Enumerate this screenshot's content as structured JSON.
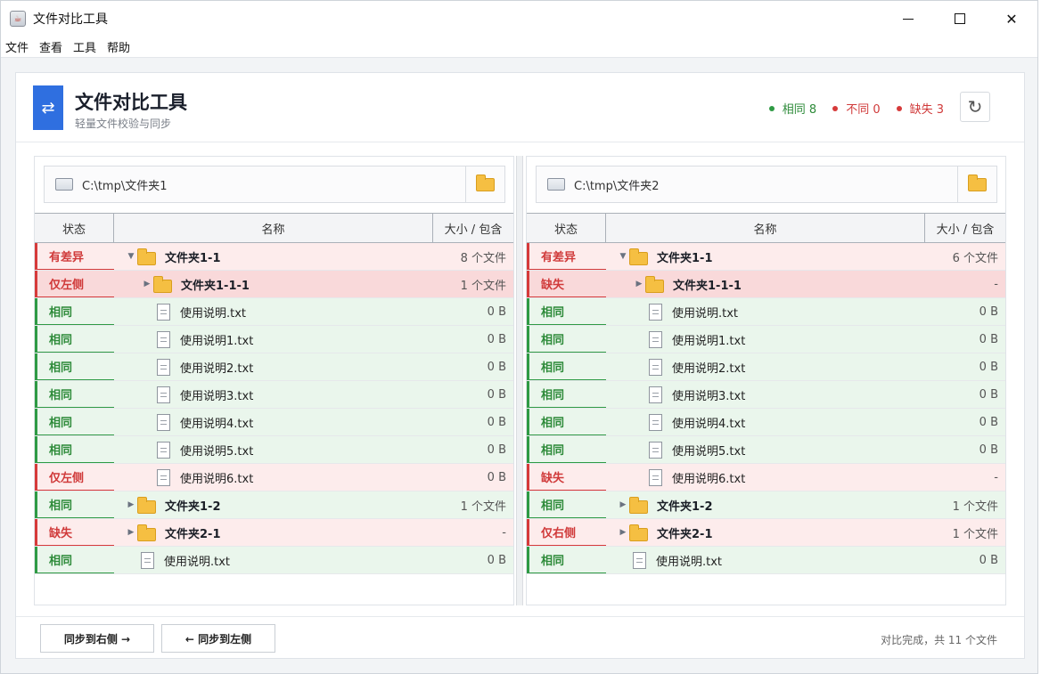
{
  "window": {
    "title": "文件对比工具"
  },
  "menu": [
    "文件",
    "查看",
    "工具",
    "帮助"
  ],
  "header": {
    "title": "文件对比工具",
    "subtitle": "轻量文件校验与同步",
    "stats": [
      {
        "label": "相同 8",
        "color": "#2e8b3a"
      },
      {
        "label": "不同 0",
        "color": "#d03a3a"
      },
      {
        "label": "缺失 3",
        "color": "#d03a3a"
      }
    ]
  },
  "columns": {
    "status": "状态",
    "name": "名称",
    "size": "大小 / 包含"
  },
  "left": {
    "path": "C:\\tmp\\文件夹1",
    "rows": [
      {
        "status": "有差异",
        "kind": "diff",
        "type": "folder",
        "depth": 0,
        "expanded": true,
        "name": "文件夹1-1",
        "size": "8 个文件"
      },
      {
        "status": "仅左侧",
        "kind": "only",
        "type": "folder",
        "depth": 1,
        "expanded": false,
        "name": "文件夹1-1-1",
        "size": "1 个文件"
      },
      {
        "status": "相同",
        "kind": "same",
        "type": "file",
        "depth": 1,
        "name": "使用说明.txt",
        "size": "0 B"
      },
      {
        "status": "相同",
        "kind": "same",
        "type": "file",
        "depth": 1,
        "name": "使用说明1.txt",
        "size": "0 B"
      },
      {
        "status": "相同",
        "kind": "same",
        "type": "file",
        "depth": 1,
        "name": "使用说明2.txt",
        "size": "0 B"
      },
      {
        "status": "相同",
        "kind": "same",
        "type": "file",
        "depth": 1,
        "name": "使用说明3.txt",
        "size": "0 B"
      },
      {
        "status": "相同",
        "kind": "same",
        "type": "file",
        "depth": 1,
        "name": "使用说明4.txt",
        "size": "0 B"
      },
      {
        "status": "相同",
        "kind": "same",
        "type": "file",
        "depth": 1,
        "name": "使用说明5.txt",
        "size": "0 B"
      },
      {
        "status": "仅左侧",
        "kind": "missing",
        "type": "file",
        "depth": 1,
        "name": "使用说明6.txt",
        "size": "0 B"
      },
      {
        "status": "相同",
        "kind": "same",
        "type": "folder",
        "depth": 0,
        "expanded": false,
        "name": "文件夹1-2",
        "size": "1 个文件"
      },
      {
        "status": "缺失",
        "kind": "missing",
        "type": "folder",
        "depth": 0,
        "expanded": false,
        "name": "文件夹2-1",
        "size": "-"
      },
      {
        "status": "相同",
        "kind": "same",
        "type": "file",
        "depth": 0,
        "name": "使用说明.txt",
        "size": "0 B"
      }
    ]
  },
  "right": {
    "path": "C:\\tmp\\文件夹2",
    "rows": [
      {
        "status": "有差异",
        "kind": "diff",
        "type": "folder",
        "depth": 0,
        "expanded": true,
        "name": "文件夹1-1",
        "size": "6 个文件"
      },
      {
        "status": "缺失",
        "kind": "only",
        "type": "folder",
        "depth": 1,
        "expanded": false,
        "name": "文件夹1-1-1",
        "size": "-"
      },
      {
        "status": "相同",
        "kind": "same",
        "type": "file",
        "depth": 1,
        "name": "使用说明.txt",
        "size": "0 B"
      },
      {
        "status": "相同",
        "kind": "same",
        "type": "file",
        "depth": 1,
        "name": "使用说明1.txt",
        "size": "0 B"
      },
      {
        "status": "相同",
        "kind": "same",
        "type": "file",
        "depth": 1,
        "name": "使用说明2.txt",
        "size": "0 B"
      },
      {
        "status": "相同",
        "kind": "same",
        "type": "file",
        "depth": 1,
        "name": "使用说明3.txt",
        "size": "0 B"
      },
      {
        "status": "相同",
        "kind": "same",
        "type": "file",
        "depth": 1,
        "name": "使用说明4.txt",
        "size": "0 B"
      },
      {
        "status": "相同",
        "kind": "same",
        "type": "file",
        "depth": 1,
        "name": "使用说明5.txt",
        "size": "0 B"
      },
      {
        "status": "缺失",
        "kind": "missing",
        "type": "file",
        "depth": 1,
        "name": "使用说明6.txt",
        "size": "-"
      },
      {
        "status": "相同",
        "kind": "same",
        "type": "folder",
        "depth": 0,
        "expanded": false,
        "name": "文件夹1-2",
        "size": "1 个文件"
      },
      {
        "status": "仅右侧",
        "kind": "missing",
        "type": "folder",
        "depth": 0,
        "expanded": false,
        "name": "文件夹2-1",
        "size": "1 个文件"
      },
      {
        "status": "相同",
        "kind": "same",
        "type": "file",
        "depth": 0,
        "name": "使用说明.txt",
        "size": "0 B"
      }
    ]
  },
  "footer": {
    "sync_right": "同步到右侧 →",
    "sync_left": "← 同步到左侧",
    "status": "对比完成，共 11 个文件"
  },
  "icons": {
    "app": "app-icon",
    "logo": "swap-arrows-icon",
    "refresh": "refresh-icon",
    "drive": "drive-icon",
    "browse": "folder-icon",
    "file": "text-file-icon"
  },
  "colors": {
    "accent": "#2f6fe0",
    "same": "#2e8b3a",
    "diff": "#d03a3a",
    "same_bg": "#eaf6ec",
    "diff_bg": "#fdecec"
  }
}
